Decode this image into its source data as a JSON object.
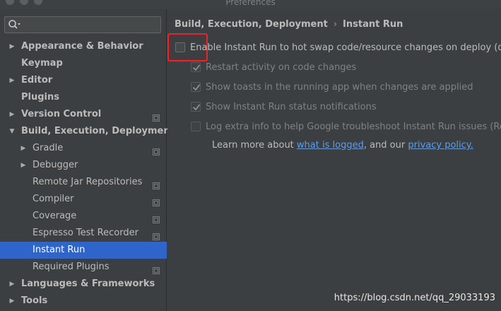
{
  "window": {
    "title": "Preferences"
  },
  "search": {
    "value": "",
    "icon": "search-icon"
  },
  "tree": [
    {
      "label": "Appearance & Behavior",
      "arrow": "▶",
      "bold": true,
      "project": false
    },
    {
      "label": "Keymap",
      "arrow": "",
      "bold": true,
      "project": false
    },
    {
      "label": "Editor",
      "arrow": "▶",
      "bold": true,
      "project": false
    },
    {
      "label": "Plugins",
      "arrow": "",
      "bold": true,
      "project": false
    },
    {
      "label": "Version Control",
      "arrow": "▶",
      "bold": true,
      "project": true
    },
    {
      "label": "Build, Execution, Deployment",
      "arrow": "▼",
      "bold": true,
      "project": false
    },
    {
      "label": "Gradle",
      "arrow": "▶",
      "bold": false,
      "project": true
    },
    {
      "label": "Debugger",
      "arrow": "▶",
      "bold": false,
      "project": false
    },
    {
      "label": "Remote Jar Repositories",
      "arrow": "",
      "bold": false,
      "project": true
    },
    {
      "label": "Compiler",
      "arrow": "",
      "bold": false,
      "project": true
    },
    {
      "label": "Coverage",
      "arrow": "",
      "bold": false,
      "project": true
    },
    {
      "label": "Espresso Test Recorder",
      "arrow": "",
      "bold": false,
      "project": true
    },
    {
      "label": "Instant Run",
      "arrow": "",
      "bold": false,
      "project": false,
      "selected": true
    },
    {
      "label": "Required Plugins",
      "arrow": "",
      "bold": false,
      "project": true
    },
    {
      "label": "Languages & Frameworks",
      "arrow": "▶",
      "bold": true,
      "project": false
    },
    {
      "label": "Tools",
      "arrow": "▶",
      "bold": true,
      "project": false
    }
  ],
  "breadcrumb": {
    "parent": "Build, Execution, Deployment",
    "separator": "›",
    "current": "Instant Run"
  },
  "options": {
    "enable": {
      "label": "Enable Instant Run to hot swap code/resource changes on deploy (defa",
      "checked": false
    },
    "restart": {
      "label": "Restart activity on code changes",
      "checked": true
    },
    "toasts": {
      "label": "Show toasts in the running app when changes are applied",
      "checked": true
    },
    "status": {
      "label": "Show Instant Run status notifications",
      "checked": true
    },
    "log": {
      "label": "Log extra info to help Google troubleshoot Instant Run issues (Reco",
      "checked": false
    }
  },
  "learn": {
    "prefix": "Learn more about ",
    "link1": "what is logged",
    "middle": ", and our ",
    "link2": "privacy policy."
  },
  "watermark": "https://blog.csdn.net/qq_29033193",
  "colors": {
    "selection": "#2f65ca",
    "link": "#589df6",
    "highlight_border": "#e8242d"
  }
}
